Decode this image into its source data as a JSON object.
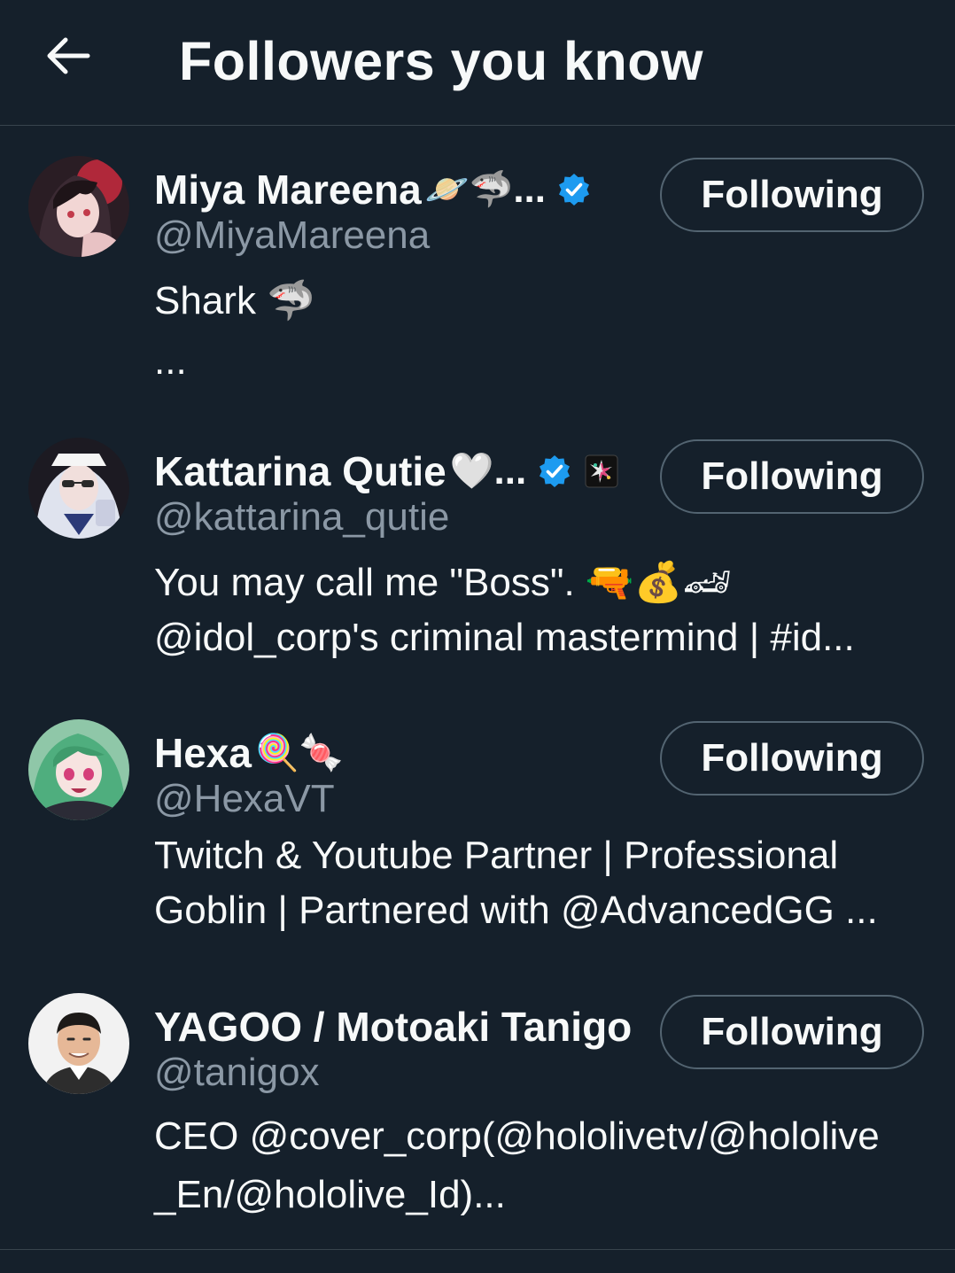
{
  "header": {
    "back_icon": "arrow-left-icon",
    "title": "Followers you know"
  },
  "colors": {
    "background": "#15202b",
    "text_primary": "#f7f9f9",
    "text_secondary": "#8b98a5",
    "verified": "#1d9bf0",
    "button_border": "#536471",
    "divider": "#38444d"
  },
  "users": [
    {
      "display_name": "Miya Mareena",
      "name_emoji": "🪐🦈",
      "truncation": "...",
      "verified": true,
      "handle": "@MiyaMareena",
      "bio_line1": "Shark 🦈",
      "bio_line2": "...",
      "button": "Following"
    },
    {
      "display_name": "Kattarina Qutie",
      "name_emoji": "🤍",
      "truncation": "...",
      "verified": true,
      "affiliate_badge": "idol-corp-badge-icon",
      "handle": "@kattarina_qutie",
      "bio_line1": "You may call me \"Boss\". 🔫💰🏎",
      "bio_line2": "@idol_corp's criminal mastermind  | #id...",
      "button": "Following"
    },
    {
      "display_name": "Hexa",
      "name_emoji": "🍭🍬",
      "handle": "@HexaVT",
      "bio_line1": "Twitch & Youtube Partner | Professional",
      "bio_line2": "Goblin | Partnered with @AdvancedGG ...",
      "button": "Following"
    },
    {
      "display_name": "YAGOO / Motoaki Tanigo",
      "handle": "@tanigox",
      "bio_line1": "CEO @cover_corp(@hololivetv/@hololive",
      "bio_line2": "_En/@hololive_Id)...",
      "button": "Following"
    }
  ]
}
